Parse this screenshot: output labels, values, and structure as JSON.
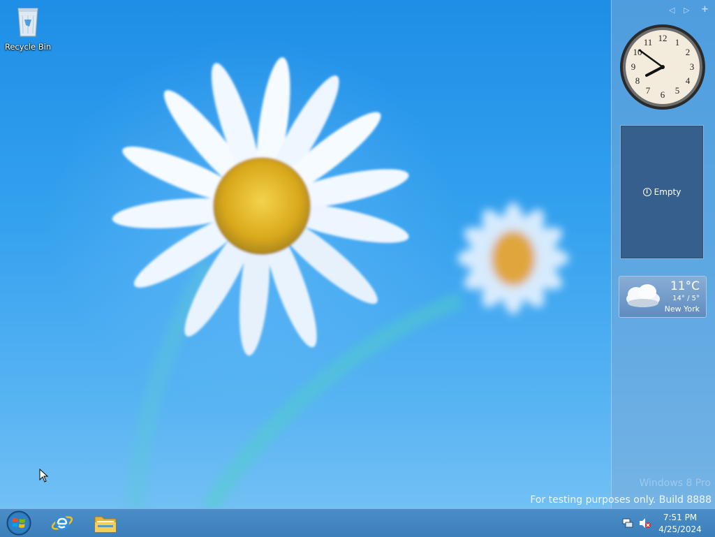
{
  "desktop": {
    "icons": [
      {
        "label": "Recycle Bin",
        "icon": "recycle-bin-icon"
      }
    ]
  },
  "sidebar": {
    "controls": [
      "previous-arrow-icon",
      "next-arrow-icon",
      "add-gadget-icon"
    ],
    "clock": {
      "numerals": [
        "12",
        "1",
        "2",
        "3",
        "4",
        "5",
        "6",
        "7",
        "8",
        "9",
        "10",
        "11"
      ],
      "time_shown": "7:51"
    },
    "empty_gadget": {
      "label": "Empty"
    },
    "weather": {
      "temperature": "11°C",
      "range": "14° / 5°",
      "city": "New York",
      "icon": "cloud-icon"
    }
  },
  "watermark": {
    "edition": "Windows 8 Pro",
    "build": "For testing purposes only. Build 8888"
  },
  "taskbar": {
    "buttons": [
      {
        "name": "start-button",
        "icon": "windows-orb-icon"
      },
      {
        "name": "internet-explorer-button",
        "icon": "internet-explorer-icon"
      },
      {
        "name": "file-explorer-button",
        "icon": "folder-icon"
      }
    ],
    "tray": {
      "icons": [
        "network-icon",
        "speaker-muted-icon"
      ],
      "time": "7:51 PM",
      "date": "4/25/2024"
    }
  },
  "colors": {
    "desktop_blue": "#1e8ee6",
    "taskbar": "#3b7fbb",
    "empty_gadget_bg": "#375f8d"
  }
}
